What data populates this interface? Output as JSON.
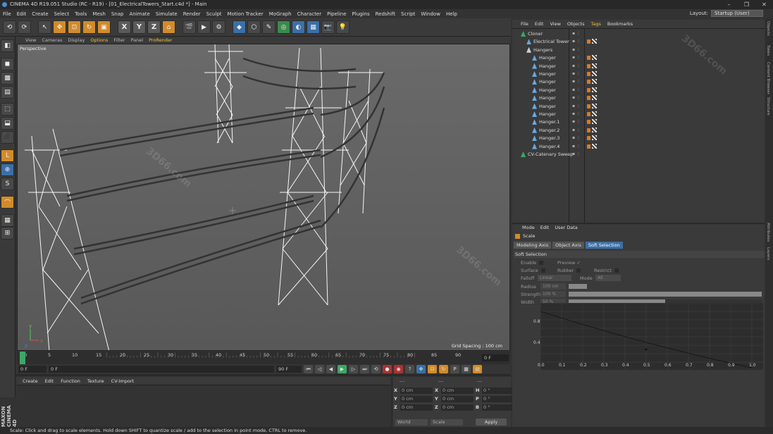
{
  "window": {
    "title": "CINEMA 4D R19.051 Studio (RC - R19) - [01_ElectricalTowers_Start.c4d *] - Main",
    "controls": [
      "–",
      "❐",
      "✕"
    ]
  },
  "menu": [
    "File",
    "Edit",
    "Create",
    "Select",
    "Tools",
    "Mesh",
    "Snap",
    "Animate",
    "Simulate",
    "Render",
    "Sculpt",
    "Motion Tracker",
    "MoGraph",
    "Character",
    "Pipeline",
    "Plugins",
    "Redshift",
    "Script",
    "Window",
    "Help"
  ],
  "layout": {
    "label": "Layout:",
    "value": "Startup (User)"
  },
  "toolbar": {
    "undo": "⟲",
    "redo": "⟳",
    "axis_x": "X",
    "axis_y": "Y",
    "axis_z": "Z"
  },
  "viewport": {
    "menu": [
      "View",
      "Cameras",
      "Display",
      "Options",
      "Filter",
      "Panel",
      "ProRender"
    ],
    "active_menu_index": 3,
    "label": "Perspective",
    "grid_spacing": "Grid Spacing : 100 cm",
    "axis_labels": [
      "y",
      "z",
      "x"
    ]
  },
  "timeline": {
    "ticks": [
      "0",
      "5",
      "10",
      "15",
      "20",
      "25",
      "30",
      "35",
      "40",
      "45",
      "50",
      "55",
      "60",
      "65",
      "70",
      "75",
      "80",
      "85",
      "90"
    ],
    "current_frame": "0 F",
    "start_field": "0 F",
    "min_field": "0 F",
    "max_field": "90 F",
    "end_field": "90 F"
  },
  "materials": {
    "menu": [
      "Create",
      "Edit",
      "Function",
      "Texture",
      "CV-Import"
    ]
  },
  "coordinates": {
    "header": [
      "---",
      "---",
      "---"
    ],
    "rows": [
      {
        "pos_label": "X",
        "pos": "0 cm",
        "size_label": "X",
        "size": "0 cm",
        "rot_label": "H",
        "rot": "0 °"
      },
      {
        "pos_label": "Y",
        "pos": "0 cm",
        "size_label": "Y",
        "size": "0 cm",
        "rot_label": "P",
        "rot": "0 °"
      },
      {
        "pos_label": "Z",
        "pos": "0 cm",
        "size_label": "Z",
        "size": "0 cm",
        "rot_label": "B",
        "rot": "0 °"
      }
    ],
    "mode": "World",
    "size_mode": "Scale",
    "apply": "Apply"
  },
  "object_manager": {
    "menu": [
      "File",
      "Edit",
      "View",
      "Objects",
      "Tags",
      "Bookmarks"
    ],
    "active_menu_index": 4,
    "objects": [
      {
        "name": "Cloner",
        "depth": 0,
        "color": "#3aa866",
        "has_tags": false
      },
      {
        "name": "Electrical Tower",
        "depth": 1,
        "color": "#6aa6e0",
        "has_tags": true
      },
      {
        "name": "Hangers",
        "depth": 1,
        "color": "#cfcfcf",
        "has_tags": false
      },
      {
        "name": "Hanger",
        "depth": 2,
        "color": "#6aa6e0",
        "has_tags": true
      },
      {
        "name": "Hanger",
        "depth": 2,
        "color": "#6aa6e0",
        "has_tags": true
      },
      {
        "name": "Hanger",
        "depth": 2,
        "color": "#6aa6e0",
        "has_tags": true
      },
      {
        "name": "Hanger",
        "depth": 2,
        "color": "#6aa6e0",
        "has_tags": true
      },
      {
        "name": "Hanger",
        "depth": 2,
        "color": "#6aa6e0",
        "has_tags": true
      },
      {
        "name": "Hanger",
        "depth": 2,
        "color": "#6aa6e0",
        "has_tags": true
      },
      {
        "name": "Hanger",
        "depth": 2,
        "color": "#6aa6e0",
        "has_tags": true
      },
      {
        "name": "Hanger",
        "depth": 2,
        "color": "#6aa6e0",
        "has_tags": true
      },
      {
        "name": "Hanger.1",
        "depth": 2,
        "color": "#6aa6e0",
        "has_tags": true
      },
      {
        "name": "Hanger.2",
        "depth": 2,
        "color": "#6aa6e0",
        "has_tags": true
      },
      {
        "name": "Hanger.3",
        "depth": 2,
        "color": "#6aa6e0",
        "has_tags": true
      },
      {
        "name": "Hanger.4",
        "depth": 2,
        "color": "#6aa6e0",
        "has_tags": true
      },
      {
        "name": "CV-Catenary Sweep",
        "depth": 0,
        "color": "#3aa866",
        "has_tags": false
      }
    ]
  },
  "attribute_manager": {
    "menu": [
      "Mode",
      "Edit",
      "User Data"
    ],
    "title": "Scale",
    "tabs": [
      "Modeling Axis",
      "Object Axis",
      "Soft Selection"
    ],
    "active_tab_index": 2,
    "section": "Soft Selection",
    "enable": "Enable",
    "preview": "Preview",
    "preview_check": "✓",
    "surface": "Surface",
    "rubber": "Rubber",
    "restrict": "Restrict",
    "falloff": "Falloff",
    "falloff_value": "Linear",
    "mode": "Mode",
    "mode_value": "All",
    "radius": "Radius",
    "radius_value": "100 cm",
    "strength": "Strength",
    "strength_value": "100 %",
    "strength_fraction": 1.0,
    "width": "Width",
    "width_value": "50 %",
    "width_fraction": 0.5,
    "graph_x": [
      "0.0",
      "0.1",
      "0.2",
      "0.3",
      "0.4",
      "0.5",
      "0.6",
      "0.7",
      "0.8",
      "0.9",
      "1.0"
    ],
    "graph_y": [
      "0.8",
      "0.4"
    ]
  },
  "right_strip": [
    "Objects",
    "Takes",
    "Content Browser",
    "Structure",
    "Attributes",
    "Layers"
  ],
  "status": "Scale: Click and drag to scale elements. Hold down SHIFT to quantize scale / add to the selection in point mode, CTRL to remove.",
  "branding": "MAXON CINEMA 4D",
  "watermark": "3D66.com",
  "colors": {
    "accent": "#f0c040",
    "selection": "#3b6fa7",
    "tag_orange": "#d87a2a"
  }
}
